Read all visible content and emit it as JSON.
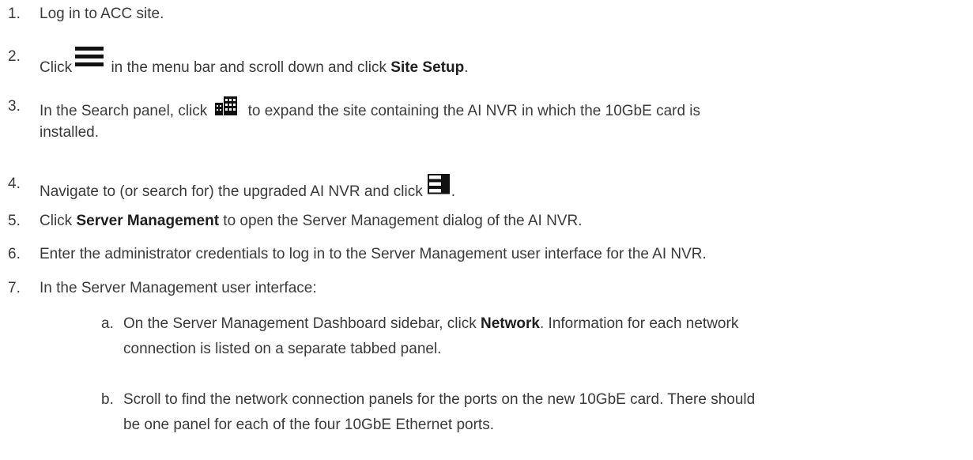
{
  "steps": [
    {
      "num": "1.",
      "text": "Log in to ACC site."
    },
    {
      "num": "2.",
      "pre": "Click",
      "icon": "hamburger-menu-icon",
      "post": " in the menu bar and scroll down and click ",
      "bold": "Site Setup",
      "end": "."
    },
    {
      "num": "3.",
      "pre": "In the Search panel, click",
      "icon": "site-building-icon",
      "post": " to expand the site containing the AI NVR in which the 10GbE card is",
      "line2": "installed."
    },
    {
      "num": "4.",
      "pre": "Navigate to (or search for) the upgraded AI NVR and click",
      "icon": "server-stack-icon",
      "end": "."
    },
    {
      "num": "5.",
      "pre": "Click ",
      "bold": "Server Management",
      "post": " to open the Server Management dialog of the AI NVR."
    },
    {
      "num": "6.",
      "text": "Enter the administrator credentials to log in to the Server Management user interface for the AI NVR."
    },
    {
      "num": "7.",
      "text": "In the Server Management user interface:"
    }
  ],
  "substeps": [
    {
      "num": "a.",
      "pre": "On the Server Management Dashboard sidebar, click ",
      "bold": "Network",
      "post": ". Information for each network",
      "line2": "connection is listed on a separate tabbed panel."
    },
    {
      "num": "b.",
      "text": "Scroll to find the network connection panels for the ports on the new 10GbE card. There should",
      "line2": "be one panel for each of the four 10GbE Ethernet ports."
    }
  ]
}
